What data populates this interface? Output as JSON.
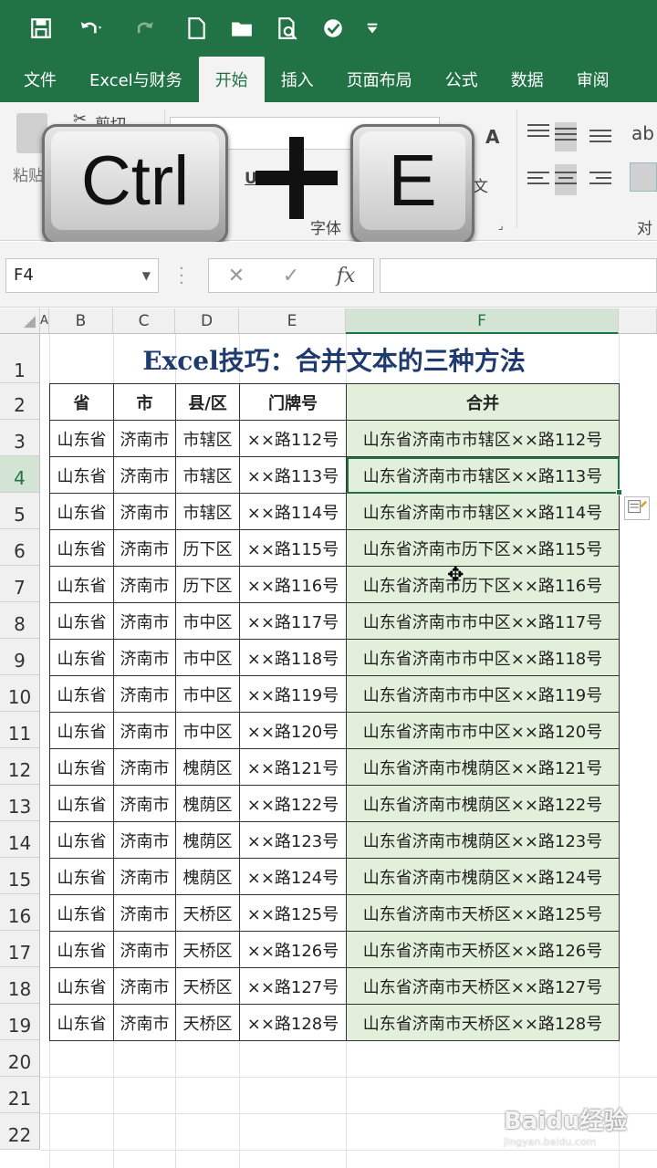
{
  "tabs": [
    {
      "label": "文件"
    },
    {
      "label": "Excel与财务"
    },
    {
      "label": "开始",
      "active": true
    },
    {
      "label": "插入"
    },
    {
      "label": "页面布局"
    },
    {
      "label": "公式"
    },
    {
      "label": "数据"
    },
    {
      "label": "审阅"
    }
  ],
  "ribbon": {
    "cut": "剪切",
    "paste": "粘贴",
    "font_group": "字体",
    "align_group": "对齐",
    "underline": "U",
    "font_a": "A",
    "wen": "文"
  },
  "overlay": {
    "key1": "Ctrl",
    "key2": "E"
  },
  "formula_bar": {
    "name_box": "F4",
    "cancel": "✕",
    "enter": "✓",
    "fx": "fx"
  },
  "columns": [
    "B",
    "C",
    "D",
    "E",
    "F"
  ],
  "corner_a": "A",
  "sheet": {
    "title": "Excel技巧：合并文本的三种方法",
    "headers": [
      "省",
      "市",
      "县/区",
      "门牌号",
      "合并"
    ],
    "rows": [
      [
        "山东省",
        "济南市",
        "市辖区",
        "××路112号",
        "山东省济南市市辖区××路112号"
      ],
      [
        "山东省",
        "济南市",
        "市辖区",
        "××路113号",
        "山东省济南市市辖区××路113号"
      ],
      [
        "山东省",
        "济南市",
        "市辖区",
        "××路114号",
        "山东省济南市市辖区××路114号"
      ],
      [
        "山东省",
        "济南市",
        "历下区",
        "××路115号",
        "山东省济南市历下区××路115号"
      ],
      [
        "山东省",
        "济南市",
        "历下区",
        "××路116号",
        "山东省济南市历下区××路116号"
      ],
      [
        "山东省",
        "济南市",
        "市中区",
        "××路117号",
        "山东省济南市市中区××路117号"
      ],
      [
        "山东省",
        "济南市",
        "市中区",
        "××路118号",
        "山东省济南市市中区××路118号"
      ],
      [
        "山东省",
        "济南市",
        "市中区",
        "××路119号",
        "山东省济南市市中区××路119号"
      ],
      [
        "山东省",
        "济南市",
        "市中区",
        "××路120号",
        "山东省济南市市中区××路120号"
      ],
      [
        "山东省",
        "济南市",
        "槐荫区",
        "××路121号",
        "山东省济南市槐荫区××路121号"
      ],
      [
        "山东省",
        "济南市",
        "槐荫区",
        "××路122号",
        "山东省济南市槐荫区××路122号"
      ],
      [
        "山东省",
        "济南市",
        "槐荫区",
        "××路123号",
        "山东省济南市槐荫区××路123号"
      ],
      [
        "山东省",
        "济南市",
        "槐荫区",
        "××路124号",
        "山东省济南市槐荫区××路124号"
      ],
      [
        "山东省",
        "济南市",
        "天桥区",
        "××路125号",
        "山东省济南市天桥区××路125号"
      ],
      [
        "山东省",
        "济南市",
        "天桥区",
        "××路126号",
        "山东省济南市天桥区××路126号"
      ],
      [
        "山东省",
        "济南市",
        "天桥区",
        "××路127号",
        "山东省济南市天桥区××路127号"
      ],
      [
        "山东省",
        "济南市",
        "天桥区",
        "××路128号",
        "山东省济南市天桥区××路128号"
      ]
    ]
  },
  "row_numbers": [
    "1",
    "2",
    "3",
    "4",
    "5",
    "6",
    "7",
    "8",
    "9",
    "10",
    "11",
    "12",
    "13",
    "14",
    "15",
    "16",
    "17",
    "18",
    "19",
    "20",
    "21",
    "22"
  ],
  "watermark": {
    "brand": "Baidu经验",
    "url": "jingyan.baidu.com"
  },
  "colors": {
    "excel_green": "#217346",
    "merge_fill": "#e2efda",
    "title_blue": "#1f3a6e"
  }
}
